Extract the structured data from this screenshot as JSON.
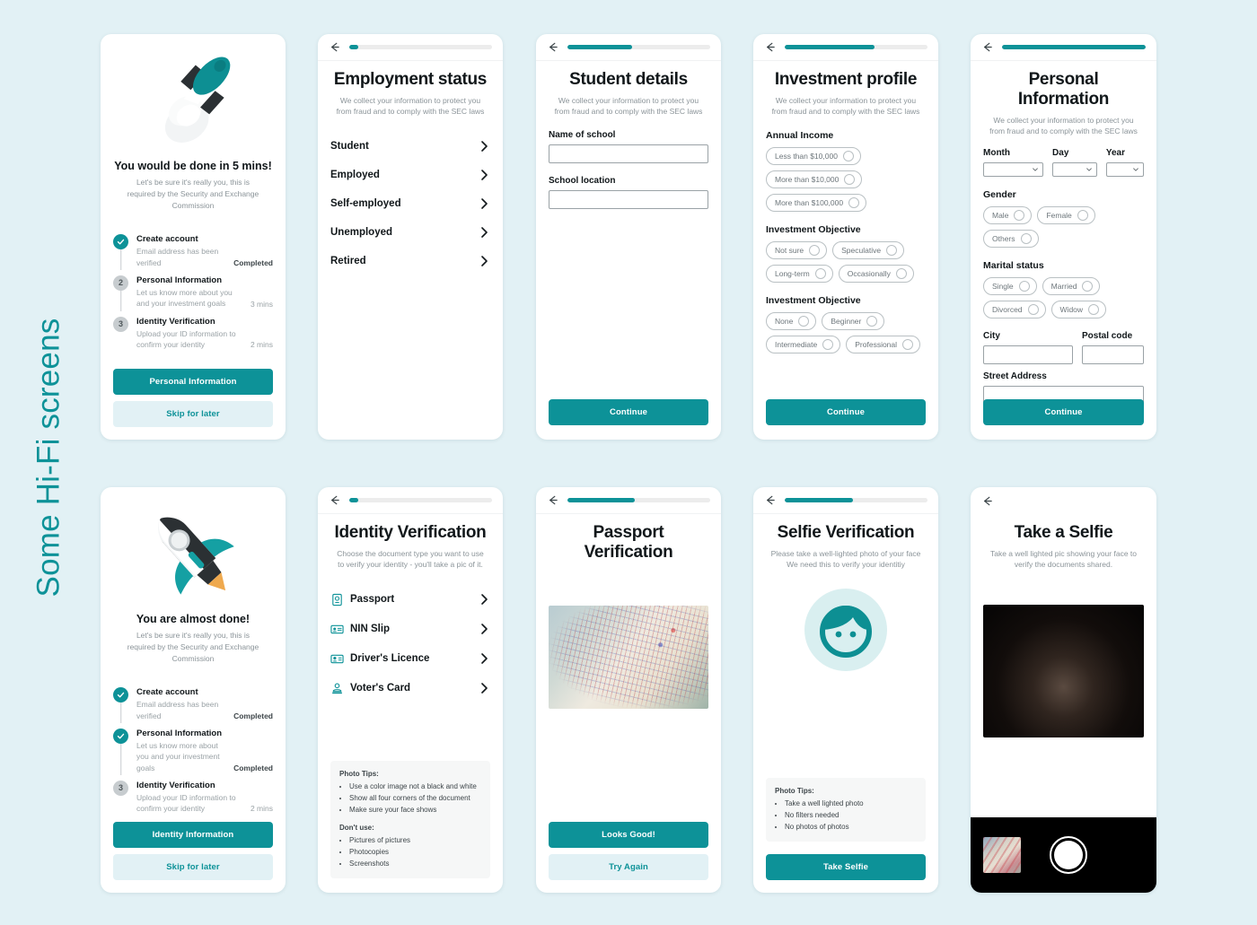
{
  "page": {
    "side_label": "Some Hi-Fi screens",
    "background_color": "#e2f1f5",
    "accent_color": "#0d9298",
    "accent_soft_color": "#e2f1f5"
  },
  "common": {
    "sec_subtitle": "We collect your information to protect you from fraud and to comply with the SEC laws",
    "continue_label": "Continue",
    "skip_label": "Skip for later"
  },
  "cards": {
    "onboarding_start": {
      "hero_title": "You would be done in 5 mins!",
      "hero_sub": "Let's be sure it's really you, this is required by the Security and Exchange Commission",
      "steps": [
        {
          "num": "1",
          "state": "done",
          "name": "Create account",
          "desc": "Email address has been verified",
          "status": "Completed"
        },
        {
          "num": "2",
          "state": "todo",
          "name": "Personal Information",
          "desc": "Let us know more about you and your investment goals",
          "status": "3 mins"
        },
        {
          "num": "3",
          "state": "todo",
          "name": "Identity Verification",
          "desc": "Upload your ID information to confirm your identity",
          "status": "2 mins"
        }
      ],
      "primary_button": "Personal Information",
      "ghost_button": "Skip for later"
    },
    "employment_status": {
      "progress": 6,
      "title": "Employment status",
      "options": [
        "Student",
        "Employed",
        "Self-employed",
        "Unemployed",
        "Retired"
      ]
    },
    "student_details": {
      "progress": 45,
      "title": "Student details",
      "fields": [
        {
          "label": "Name of school",
          "value": ""
        },
        {
          "label": "School location",
          "value": ""
        }
      ],
      "button": "Continue"
    },
    "investment_profile": {
      "progress": 63,
      "title": "Investment profile",
      "groups": [
        {
          "title": "Annual Income",
          "chips": [
            "Less than $10,000",
            "More than $10,000",
            "More than $100,000"
          ]
        },
        {
          "title": "Investment Objective",
          "chips": [
            "Not sure",
            "Speculative",
            "Long-term",
            "Occasionally"
          ]
        },
        {
          "title": "Investment Objective",
          "chips": [
            "None",
            "Beginner",
            "Intermediate",
            "Professional"
          ]
        }
      ],
      "button": "Continue"
    },
    "personal_information": {
      "progress": 100,
      "title": "Personal Information",
      "dob": [
        {
          "label": "Month",
          "value": ""
        },
        {
          "label": "Day",
          "value": ""
        },
        {
          "label": "Year",
          "value": ""
        }
      ],
      "gender": {
        "title": "Gender",
        "chips": [
          "Male",
          "Female",
          "Others"
        ]
      },
      "marital": {
        "title": "Marital status",
        "chips": [
          "Single",
          "Married",
          "Divorced",
          "Widow"
        ]
      },
      "city": {
        "label": "City",
        "value": ""
      },
      "postal": {
        "label": "Postal code",
        "value": ""
      },
      "street": {
        "label": "Street Address",
        "value": ""
      },
      "button": "Continue"
    },
    "almost_done": {
      "hero_title": "You are almost done!",
      "hero_sub": "Let's be sure it's really you, this is required by the Security and Exchange Commission",
      "steps": [
        {
          "num": "1",
          "state": "done",
          "name": "Create account",
          "desc": "Email address has been verified",
          "status": "Completed"
        },
        {
          "num": "2",
          "state": "done",
          "name": "Personal Information",
          "desc": "Let us know more about you and your investment goals",
          "status": "Completed"
        },
        {
          "num": "3",
          "state": "todo",
          "name": "Identity Verification",
          "desc": "Upload your ID information to confirm your identity",
          "status": "2 mins"
        }
      ],
      "primary_button": "Identity Information",
      "ghost_button": "Skip for later"
    },
    "identity_verification": {
      "progress": 6,
      "title": "Identity Verification",
      "subtitle": "Choose the document type you want to use to verify your identity - you'll take a pic of it.",
      "documents": [
        {
          "label": "Passport",
          "icon": "passport-icon"
        },
        {
          "label": "NIN Slip",
          "icon": "id-card-icon"
        },
        {
          "label": "Driver's Licence",
          "icon": "drivers-licence-icon"
        },
        {
          "label": "Voter's Card",
          "icon": "voter-card-icon"
        }
      ],
      "tips": {
        "heading": "Photo Tips:",
        "items": [
          "Use a color image not a black and white",
          "Show all four corners of the document",
          "Make sure your face shows"
        ],
        "dont_heading": "Don't use:",
        "dont_items": [
          "Pictures of pictures",
          "Photocopies",
          "Screenshots"
        ]
      }
    },
    "passport_verification": {
      "progress": 47,
      "title": "Passport Verification",
      "primary_button": "Looks Good!",
      "ghost_button": "Try Again"
    },
    "selfie_verification": {
      "progress": 48,
      "title": "Selfie Verification",
      "subtitle": "Please take a well-lighted photo of your face We need this to verify your identitiy",
      "tips": {
        "heading": "Photo Tips:",
        "items": [
          "Take a well lighted photo",
          "No filters needed",
          "No photos of photos"
        ]
      },
      "button": "Take Selfie"
    },
    "take_a_selfie": {
      "title": "Take a Selfie",
      "subtitle": "Take a well lighted pic showing your face to verify the documents shared."
    }
  }
}
